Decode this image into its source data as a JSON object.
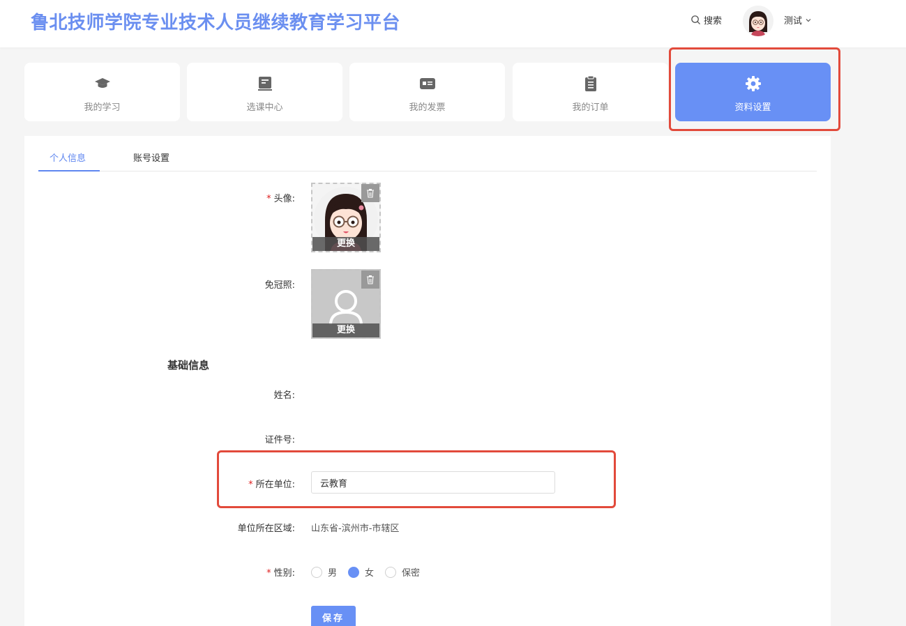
{
  "header": {
    "title": "鲁北技师学院专业技术人员继续教育学习平台",
    "search_label": "搜索",
    "user_name": "测试"
  },
  "nav": [
    {
      "label": "我的学习",
      "icon": "graduation-cap-icon",
      "active": false
    },
    {
      "label": "选课中心",
      "icon": "course-board-icon",
      "active": false
    },
    {
      "label": "我的发票",
      "icon": "invoice-card-icon",
      "active": false
    },
    {
      "label": "我的订单",
      "icon": "order-clipboard-icon",
      "active": false
    },
    {
      "label": "资料设置",
      "icon": "gear-icon",
      "active": true
    }
  ],
  "tabs": [
    {
      "label": "个人信息",
      "active": true
    },
    {
      "label": "账号设置",
      "active": false
    }
  ],
  "form": {
    "avatar_label": "头像:",
    "photo_label": "免冠照:",
    "change_label": "更换",
    "section_title": "基础信息",
    "name_label": "姓名:",
    "name_value": "",
    "id_label": "证件号:",
    "id_value": "",
    "org_label": "所在单位:",
    "org_value": "云教育",
    "region_label": "单位所在区域:",
    "region_value": "山东省-滨州市-市辖区",
    "gender_label": "性别:",
    "gender_options": [
      "男",
      "女",
      "保密"
    ],
    "gender_selected": "女",
    "save_label": "保存"
  },
  "colors": {
    "accent": "#6890f5",
    "title": "#6b8ff0",
    "highlight_border": "#e24a3b",
    "required": "#e02020"
  }
}
